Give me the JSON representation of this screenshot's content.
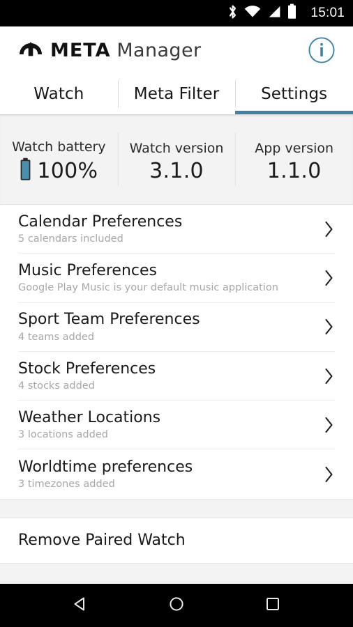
{
  "status_bar": {
    "clock": "15:01",
    "icons": [
      "bluetooth-icon",
      "wifi-icon",
      "cell-signal-icon",
      "battery-icon"
    ]
  },
  "header": {
    "logo_icon": "meta-logo-icon",
    "brand_bold": "META",
    "brand_light": "Manager",
    "info_icon": "info-icon",
    "info_letter": "i",
    "accent_color": "#3e83a6"
  },
  "tabs": [
    {
      "label": "Watch",
      "active": false
    },
    {
      "label": "Meta Filter",
      "active": false
    },
    {
      "label": "Settings",
      "active": true
    }
  ],
  "info_panel": {
    "columns": [
      {
        "label": "Watch battery",
        "value": "100%",
        "icon": "battery-full-icon"
      },
      {
        "label": "Watch version",
        "value": "3.1.0",
        "icon": ""
      },
      {
        "label": "App version",
        "value": "1.1.0",
        "icon": ""
      }
    ],
    "battery_color": "#4a8fae"
  },
  "settings": {
    "rows": [
      {
        "title": "Calendar Preferences",
        "subtitle": "5 calendars included",
        "chevron": "chevron-right-icon"
      },
      {
        "title": "Music Preferences",
        "subtitle": "Google Play Music is your default music application",
        "chevron": "chevron-right-icon"
      },
      {
        "title": "Sport Team Preferences",
        "subtitle": "4 teams added",
        "chevron": "chevron-right-icon"
      },
      {
        "title": "Stock Preferences",
        "subtitle": "4 stocks added",
        "chevron": "chevron-right-icon"
      },
      {
        "title": "Weather Locations",
        "subtitle": "3 locations added",
        "chevron": "chevron-right-icon"
      },
      {
        "title": "Worldtime preferences",
        "subtitle": "3 timezones added",
        "chevron": "chevron-right-icon"
      }
    ]
  },
  "actions": {
    "remove_paired_watch": "Remove Paired Watch"
  },
  "nav_bar": {
    "back": "back-triangle-icon",
    "home": "home-circle-icon",
    "recents": "recents-square-icon"
  }
}
